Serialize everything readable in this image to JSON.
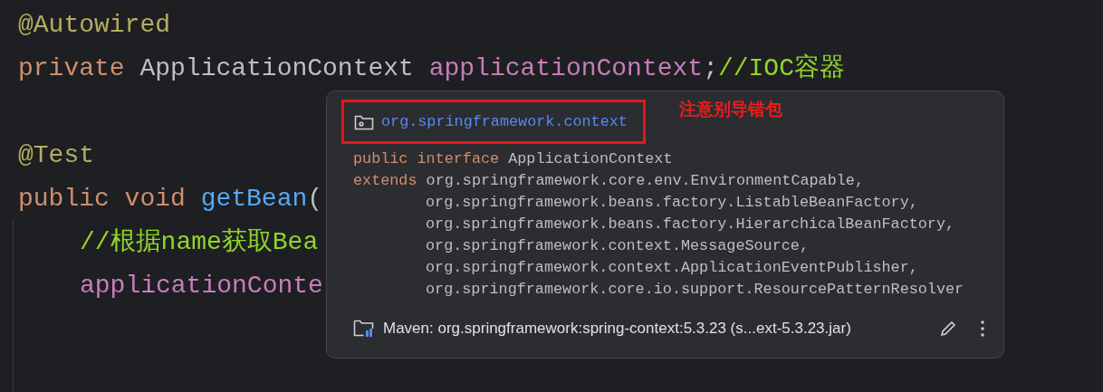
{
  "code_lines": [
    {
      "indented": false,
      "blank_line_before": false,
      "tokens": [
        {
          "kind": "annotation",
          "text": "@Autowired"
        }
      ]
    },
    {
      "indented": false,
      "blank_line_before": false,
      "tokens": [
        {
          "kind": "keyword",
          "text": "private"
        },
        {
          "kind": "plain",
          "text": " ApplicationContext "
        },
        {
          "kind": "field",
          "text": "applicationContext"
        },
        {
          "kind": "plain",
          "text": ";"
        },
        {
          "kind": "comment",
          "text": "//IOC容器"
        }
      ]
    },
    {
      "indented": false,
      "blank_line_before": true,
      "tokens": [
        {
          "kind": "annotation",
          "text": "@Test"
        }
      ]
    },
    {
      "indented": false,
      "blank_line_before": false,
      "tokens": [
        {
          "kind": "keyword",
          "text": "public void "
        },
        {
          "kind": "method",
          "text": "getBean"
        },
        {
          "kind": "plain",
          "text": "("
        }
      ]
    },
    {
      "indented": true,
      "blank_line_before": false,
      "tokens": [
        {
          "kind": "comment",
          "text": "//根据name获取Bea"
        }
      ]
    },
    {
      "indented": true,
      "blank_line_before": false,
      "tokens": [
        {
          "kind": "field",
          "text": "applicationConte"
        }
      ]
    }
  ],
  "doc_popup": {
    "package": "org.springframework.context",
    "note": "注意别导错包",
    "declaration": [
      {
        "keyword": "public interface",
        "text": "ApplicationContext"
      },
      {
        "keyword": "extends",
        "text": "org.springframework.core.env.EnvironmentCapable,"
      },
      {
        "text": "org.springframework.beans.factory.ListableBeanFactory,"
      },
      {
        "text": "org.springframework.beans.factory.HierarchicalBeanFactory,"
      },
      {
        "text": "org.springframework.context.MessageSource,"
      },
      {
        "text": "org.springframework.context.ApplicationEventPublisher,"
      },
      {
        "text": "org.springframework.core.io.support.ResourcePatternResolver"
      }
    ],
    "library": "Maven: org.springframework:spring-context:5.3.23 (s...ext-5.3.23.jar)"
  }
}
